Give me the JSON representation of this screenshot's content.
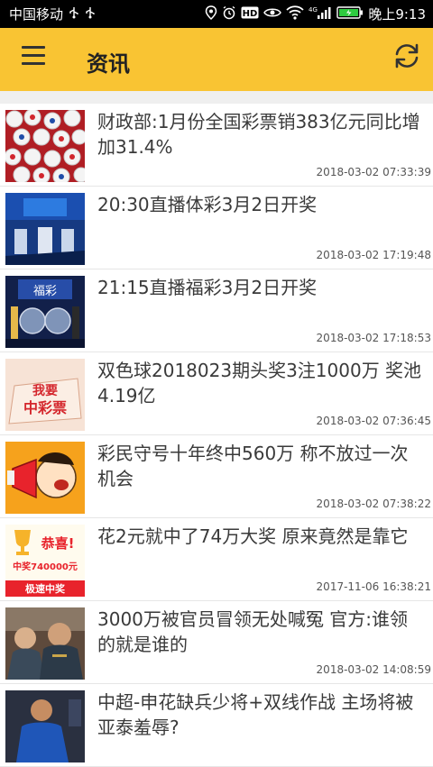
{
  "status": {
    "carrier": "中国移动",
    "time": "晚上9:13",
    "network": "4G"
  },
  "header": {
    "title": "资讯"
  },
  "news": [
    {
      "title": "财政部:1月份全国彩票销383亿元同比增加31.4%",
      "date": "2018-03-02 07:33:39"
    },
    {
      "title": "20:30直播体彩3月2日开奖",
      "date": "2018-03-02 17:19:48"
    },
    {
      "title": "21:15直播福彩3月2日开奖",
      "date": "2018-03-02 17:18:53"
    },
    {
      "title": "双色球2018023期头奖3注1000万 奖池4.19亿",
      "date": "2018-03-02 07:36:45"
    },
    {
      "title": "彩民守号十年终中560万 称不放过一次机会",
      "date": "2018-03-02 07:38:22"
    },
    {
      "title": "花2元就中了74万大奖 原来竟然是靠它",
      "date": "2017-11-06 16:38:21"
    },
    {
      "title": "3000万被官员冒领无处喊冤 官方:谁领的就是谁的",
      "date": "2018-03-02 14:08:59"
    },
    {
      "title": "中超-申花缺兵少将+双线作战 主场将被亚泰羞辱?",
      "date": ""
    }
  ],
  "thumb_text": {
    "t3": "福彩",
    "t4_line1": "我要",
    "t4_line2": "中彩票",
    "t6_top": "恭喜!",
    "t6_amount": "中奖740000元",
    "t6_band": "极速中奖"
  }
}
